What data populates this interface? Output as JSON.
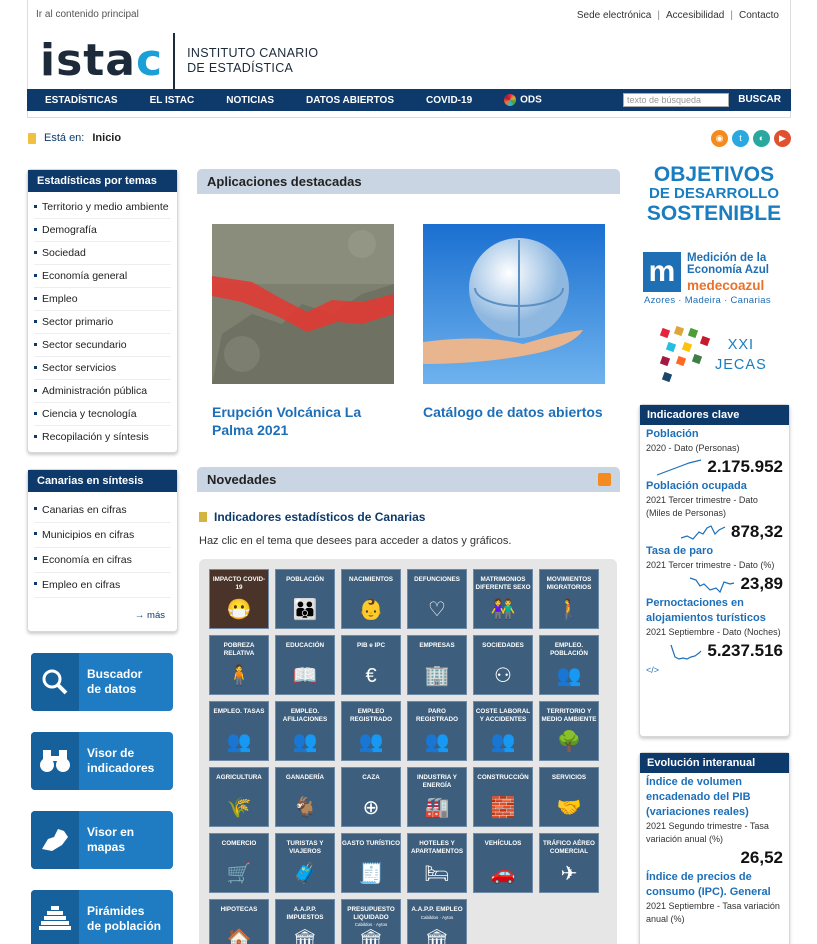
{
  "header": {
    "skip_link": "Ir al contenido principal",
    "top_links": [
      "Sede electrónica",
      "Accesibilidad",
      "Contacto"
    ],
    "logo_word_a": "ista",
    "logo_word_c": "c",
    "logo_line1": "INSTITUTO CANARIO",
    "logo_line2": "DE ESTADÍSTICA"
  },
  "nav": {
    "items": [
      "ESTADÍSTICAS",
      "EL ISTAC",
      "NOTICIAS",
      "DATOS ABIERTOS",
      "COVID-19",
      "ODS"
    ],
    "search_placeholder": "texto de búsqueda",
    "search_button": "BUSCAR"
  },
  "breadcrumb": {
    "label": "Está en:",
    "current": "Inicio"
  },
  "social_icons": [
    "rss-icon",
    "twitter-icon",
    "github-icon",
    "youtube-icon"
  ],
  "sidebar": {
    "temas": {
      "title": "Estadísticas por temas",
      "items": [
        "Territorio y medio ambiente",
        "Demografía",
        "Sociedad",
        "Economía general",
        "Empleo",
        "Sector primario",
        "Sector secundario",
        "Sector servicios",
        "Administración pública",
        "Ciencia y tecnología",
        "Recopilación y síntesis"
      ]
    },
    "sintesis": {
      "title": "Canarias en síntesis",
      "items": [
        "Canarias en cifras",
        "Municipios en cifras",
        "Economía en cifras",
        "Empleo en cifras"
      ],
      "more": "→ más"
    },
    "tools": [
      {
        "line1": "Buscador",
        "line2": "de datos",
        "icon": "search-icon"
      },
      {
        "line1": "Visor de",
        "line2": "indicadores",
        "icon": "binoculars-icon"
      },
      {
        "line1": "Visor en",
        "line2": "mapas",
        "icon": "map-icon"
      },
      {
        "line1": "Pirámides",
        "line2": "de población",
        "icon": "pyramid-icon"
      }
    ]
  },
  "apps": {
    "title": "Aplicaciones destacadas",
    "cards": [
      {
        "title": "Erupción Volcánica La Palma 2021"
      },
      {
        "title": "Catálogo de datos abiertos"
      }
    ]
  },
  "novedades": {
    "title": "Novedades",
    "indicators_title": "Indicadores estadísticos de Canarias",
    "intro": "Haz clic en el tema que desees para acceder a datos y gráficos.",
    "tiles": [
      {
        "label": "IMPACTO COVID-19",
        "glyph": "😷"
      },
      {
        "label": "POBLACIÓN",
        "glyph": "👪"
      },
      {
        "label": "NACIMIENTOS",
        "glyph": "👶"
      },
      {
        "label": "DEFUNCIONES",
        "glyph": "♡"
      },
      {
        "label": "MATRIMONIOS DIFERENTE SEXO",
        "glyph": "👫"
      },
      {
        "label": "MOVIMIENTOS MIGRATORIOS",
        "glyph": "🚶"
      },
      {
        "label": "POBREZA RELATIVA",
        "glyph": "🧍"
      },
      {
        "label": "EDUCACIÓN",
        "glyph": "📖"
      },
      {
        "label": "PIB e IPC",
        "glyph": "€"
      },
      {
        "label": "EMPRESAS",
        "glyph": "🏢"
      },
      {
        "label": "SOCIEDADES",
        "glyph": "⚇"
      },
      {
        "label": "EMPLEO. POBLACIÓN",
        "glyph": "👥"
      },
      {
        "label": "EMPLEO. TASAS",
        "glyph": "👥"
      },
      {
        "label": "EMPLEO. AFILIACIONES",
        "glyph": "👥"
      },
      {
        "label": "EMPLEO REGISTRADO",
        "glyph": "👥"
      },
      {
        "label": "PARO REGISTRADO",
        "glyph": "👥"
      },
      {
        "label": "COSTE LABORAL Y ACCIDENTES",
        "glyph": "👥"
      },
      {
        "label": "TERRITORIO Y MEDIO AMBIENTE",
        "glyph": "🌳"
      },
      {
        "label": "AGRICULTURA",
        "glyph": "🌾"
      },
      {
        "label": "GANADERÍA",
        "glyph": "🐐"
      },
      {
        "label": "CAZA",
        "glyph": "⊕"
      },
      {
        "label": "INDUSTRIA Y ENERGÍA",
        "glyph": "🏭"
      },
      {
        "label": "CONSTRUCCIÓN",
        "glyph": "🧱"
      },
      {
        "label": "SERVICIOS",
        "glyph": "🤝"
      },
      {
        "label": "COMERCIO",
        "glyph": "🛒"
      },
      {
        "label": "TURISTAS Y VIAJEROS",
        "glyph": "🧳"
      },
      {
        "label": "GASTO TURÍSTICO",
        "glyph": "🧾"
      },
      {
        "label": "HOTELES Y APARTAMENTOS",
        "glyph": "🛏"
      },
      {
        "label": "VEHÍCULOS",
        "glyph": "🚗"
      },
      {
        "label": "TRÁFICO AÉREO COMERCIAL",
        "glyph": "✈"
      },
      {
        "label": "HIPOTECAS",
        "glyph": "🏠"
      },
      {
        "label": "A.A.P.P. IMPUESTOS",
        "glyph": "🏛"
      },
      {
        "label": "PRESUPUESTO LIQUIDADO",
        "sub": "Cabildos · Aytos",
        "glyph": "🏛"
      },
      {
        "label": "A.A.P.P. EMPLEO",
        "sub": "Cabildos · Aytos",
        "glyph": "🏛"
      }
    ]
  },
  "right": {
    "ods_line1": "OBJETIVOS",
    "ods_line2": "DE DESARROLLO",
    "ods_line3": "SOSTENIBLE",
    "azul_line1": "Medición de la",
    "azul_line2": "Economía Azul",
    "azul_brand": "medecoazul",
    "azul_regions": "Azores · Madeira · Canarias",
    "jecas_line1": "XXI",
    "jecas_line2": "JECAS",
    "key_indicators": {
      "title": "Indicadores clave",
      "items": [
        {
          "name": "Población",
          "meta": "2020 - Dato (Personas)",
          "value": "2.175.952"
        },
        {
          "name": "Población ocupada",
          "meta": "2021 Tercer trimestre - Dato (Miles de Personas)",
          "value": "878,32"
        },
        {
          "name": "Tasa de paro",
          "meta": "2021 Tercer trimestre - Dato (%)",
          "value": "23,89"
        },
        {
          "name": "Pernoctaciones en alojamientos turísticos",
          "meta": "2021 Septiembre - Dato (Noches)",
          "value": "5.237.516"
        }
      ],
      "code_link": "</>"
    },
    "evolution": {
      "title": "Evolución interanual",
      "items": [
        {
          "name": "Índice de volumen encadenado del PIB (variaciones reales)",
          "meta": "2021 Segundo trimestre - Tasa variación anual (%)",
          "value": "26,52"
        },
        {
          "name": "Índice de precios de consumo (IPC). General",
          "meta": "2021 Septiembre - Tasa variación anual (%)",
          "value": ""
        }
      ]
    }
  },
  "colors": {
    "nav": "#0e3a6b",
    "link": "#1d6fb8",
    "tile": "#3d5f7d",
    "accent": "#1f7cc2"
  }
}
